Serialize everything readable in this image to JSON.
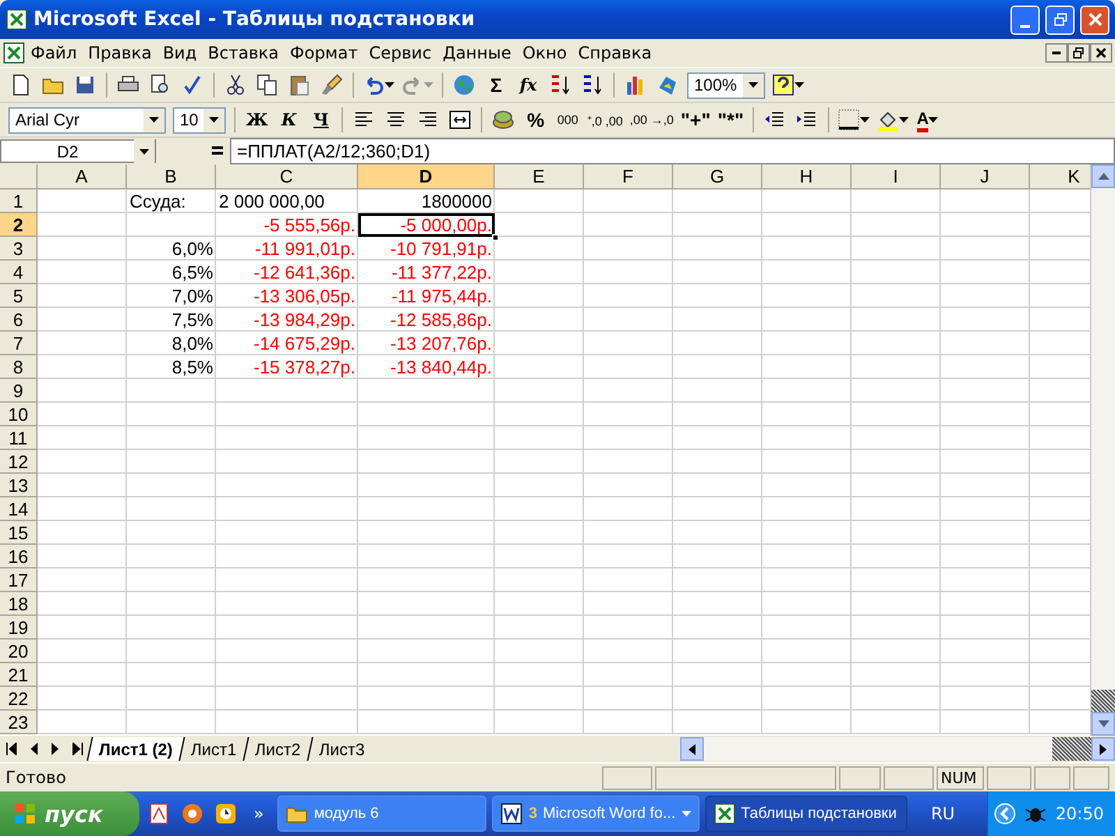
{
  "window": {
    "title": "Microsoft Excel - Таблицы подстановки"
  },
  "menu": [
    "Файл",
    "Правка",
    "Вид",
    "Вставка",
    "Формат",
    "Сервис",
    "Данные",
    "Окно",
    "Справка"
  ],
  "standard_toolbar": [
    {
      "kind": "new"
    },
    {
      "kind": "open"
    },
    {
      "kind": "save"
    },
    {
      "kind": "sep"
    },
    {
      "kind": "print"
    },
    {
      "kind": "preview"
    },
    {
      "kind": "spell"
    },
    {
      "kind": "sep"
    },
    {
      "kind": "cut"
    },
    {
      "kind": "copy"
    },
    {
      "kind": "paste"
    },
    {
      "kind": "brush"
    },
    {
      "kind": "sep"
    },
    {
      "kind": "undo"
    },
    {
      "kind": "redo"
    },
    {
      "kind": "sep"
    },
    {
      "kind": "globe"
    },
    {
      "kind": "text",
      "text": "Σ"
    },
    {
      "kind": "italic",
      "text": "fx"
    },
    {
      "kind": "sortasc"
    },
    {
      "kind": "sortdesc"
    },
    {
      "kind": "sep"
    },
    {
      "kind": "chart"
    },
    {
      "kind": "map"
    },
    {
      "kind": "combo",
      "text": "100%"
    },
    {
      "kind": "help"
    }
  ],
  "format_toolbar": [
    {
      "kind": "combo",
      "text": "Arial Cyr"
    },
    {
      "kind": "combo",
      "text": "10"
    },
    {
      "kind": "sep"
    },
    {
      "kind": "bold",
      "text": "Ж"
    },
    {
      "kind": "italic",
      "text": "К"
    },
    {
      "kind": "underline",
      "text": "Ч"
    },
    {
      "kind": "sep"
    },
    {
      "kind": "left"
    },
    {
      "kind": "center"
    },
    {
      "kind": "right"
    },
    {
      "kind": "merge"
    },
    {
      "kind": "sep"
    },
    {
      "kind": "money"
    },
    {
      "kind": "text",
      "text": "%"
    },
    {
      "kind": "small",
      "text": "000"
    },
    {
      "kind": "small",
      "text": "⁺,0 ,00"
    },
    {
      "kind": "small",
      "text": ",00 →,0"
    },
    {
      "kind": "text",
      "text": "\"+\""
    },
    {
      "kind": "text",
      "text": "\"*\""
    },
    {
      "kind": "sep"
    },
    {
      "kind": "outdent"
    },
    {
      "kind": "indent"
    },
    {
      "kind": "sep"
    },
    {
      "kind": "borders"
    },
    {
      "kind": "fill"
    },
    {
      "kind": "fontcolor",
      "text": "A"
    }
  ],
  "name_box": "D2",
  "formula": "=ППЛАТ(A2/12;360;D1)",
  "columns": [
    {
      "label": "A",
      "selected": false
    },
    {
      "label": "B",
      "selected": false
    },
    {
      "label": "C",
      "selected": false
    },
    {
      "label": "D",
      "selected": true
    },
    {
      "label": "E",
      "selected": false
    },
    {
      "label": "F",
      "selected": false
    },
    {
      "label": "G",
      "selected": false
    },
    {
      "label": "H",
      "selected": false
    },
    {
      "label": "I",
      "selected": false
    },
    {
      "label": "J",
      "selected": false
    },
    {
      "label": "K",
      "selected": false
    }
  ],
  "rows": [
    {
      "label": "1",
      "selected": false,
      "cells": [
        null,
        {
          "text": "Ссуда:",
          "kind": "text",
          "color": "#000000",
          "selected": false
        },
        {
          "text": "2 000 000,00",
          "kind": "text",
          "color": "#000000",
          "selected": false
        },
        {
          "text": "1800000",
          "kind": "number",
          "color": "#000000",
          "selected": false
        }
      ]
    },
    {
      "label": "2",
      "selected": true,
      "cells": [
        null,
        null,
        {
          "text": "-5 555,56р.",
          "kind": "number",
          "color": "#ff0000",
          "selected": false
        },
        {
          "text": "-5 000,00р.",
          "kind": "number",
          "color": "#ff0000",
          "selected": true
        }
      ]
    },
    {
      "label": "3",
      "selected": false,
      "cells": [
        null,
        {
          "text": "6,0%",
          "kind": "number",
          "color": "#000000",
          "selected": false
        },
        {
          "text": "-11 991,01р.",
          "kind": "number",
          "color": "#ff0000",
          "selected": false
        },
        {
          "text": "-10 791,91р.",
          "kind": "number",
          "color": "#ff0000",
          "selected": false
        }
      ]
    },
    {
      "label": "4",
      "selected": false,
      "cells": [
        null,
        {
          "text": "6,5%",
          "kind": "number",
          "color": "#000000",
          "selected": false
        },
        {
          "text": "-12 641,36р.",
          "kind": "number",
          "color": "#ff0000",
          "selected": false
        },
        {
          "text": "-11 377,22р.",
          "kind": "number",
          "color": "#ff0000",
          "selected": false
        }
      ]
    },
    {
      "label": "5",
      "selected": false,
      "cells": [
        null,
        {
          "text": "7,0%",
          "kind": "number",
          "color": "#000000",
          "selected": false
        },
        {
          "text": "-13 306,05р.",
          "kind": "number",
          "color": "#ff0000",
          "selected": false
        },
        {
          "text": "-11 975,44р.",
          "kind": "number",
          "color": "#ff0000",
          "selected": false
        }
      ]
    },
    {
      "label": "6",
      "selected": false,
      "cells": [
        null,
        {
          "text": "7,5%",
          "kind": "number",
          "color": "#000000",
          "selected": false
        },
        {
          "text": "-13 984,29р.",
          "kind": "number",
          "color": "#ff0000",
          "selected": false
        },
        {
          "text": "-12 585,86р.",
          "kind": "number",
          "color": "#ff0000",
          "selected": false
        }
      ]
    },
    {
      "label": "7",
      "selected": false,
      "cells": [
        null,
        {
          "text": "8,0%",
          "kind": "number",
          "color": "#000000",
          "selected": false
        },
        {
          "text": "-14 675,29р.",
          "kind": "number",
          "color": "#ff0000",
          "selected": false
        },
        {
          "text": "-13 207,76р.",
          "kind": "number",
          "color": "#ff0000",
          "selected": false
        }
      ]
    },
    {
      "label": "8",
      "selected": false,
      "cells": [
        null,
        {
          "text": "8,5%",
          "kind": "number",
          "color": "#000000",
          "selected": false
        },
        {
          "text": "-15 378,27р.",
          "kind": "number",
          "color": "#ff0000",
          "selected": false
        },
        {
          "text": "-13 840,44р.",
          "kind": "number",
          "color": "#ff0000",
          "selected": false
        }
      ]
    },
    {
      "label": "9",
      "selected": false
    },
    {
      "label": "10",
      "selected": false
    },
    {
      "label": "11",
      "selected": false
    },
    {
      "label": "12",
      "selected": false
    },
    {
      "label": "13",
      "selected": false
    },
    {
      "label": "14",
      "selected": false
    },
    {
      "label": "15",
      "selected": false
    },
    {
      "label": "16",
      "selected": false
    },
    {
      "label": "17",
      "selected": false
    },
    {
      "label": "18",
      "selected": false
    },
    {
      "label": "19",
      "selected": false
    },
    {
      "label": "20",
      "selected": false
    },
    {
      "label": "21",
      "selected": false
    },
    {
      "label": "22",
      "selected": false
    },
    {
      "label": "23",
      "selected": false
    }
  ],
  "sheet_tabs": [
    {
      "label": "Лист1 (2)",
      "selected": true
    },
    {
      "label": "Лист1",
      "selected": false
    },
    {
      "label": "Лист2",
      "selected": false
    },
    {
      "label": "Лист3",
      "selected": false
    }
  ],
  "status_bar": {
    "text": "Готово",
    "indicator": "NUM"
  },
  "taskbar": {
    "start": "пуск",
    "more": "»",
    "tasks": [
      {
        "label": "модуль 6",
        "kind": "folder",
        "selected": false
      },
      {
        "label": "Microsoft Word fo...",
        "count": "3",
        "kind": "word",
        "selected": false
      },
      {
        "label": "Таблицы подстановки",
        "kind": "excel",
        "selected": true
      }
    ],
    "language": "RU",
    "time": "20:50"
  }
}
